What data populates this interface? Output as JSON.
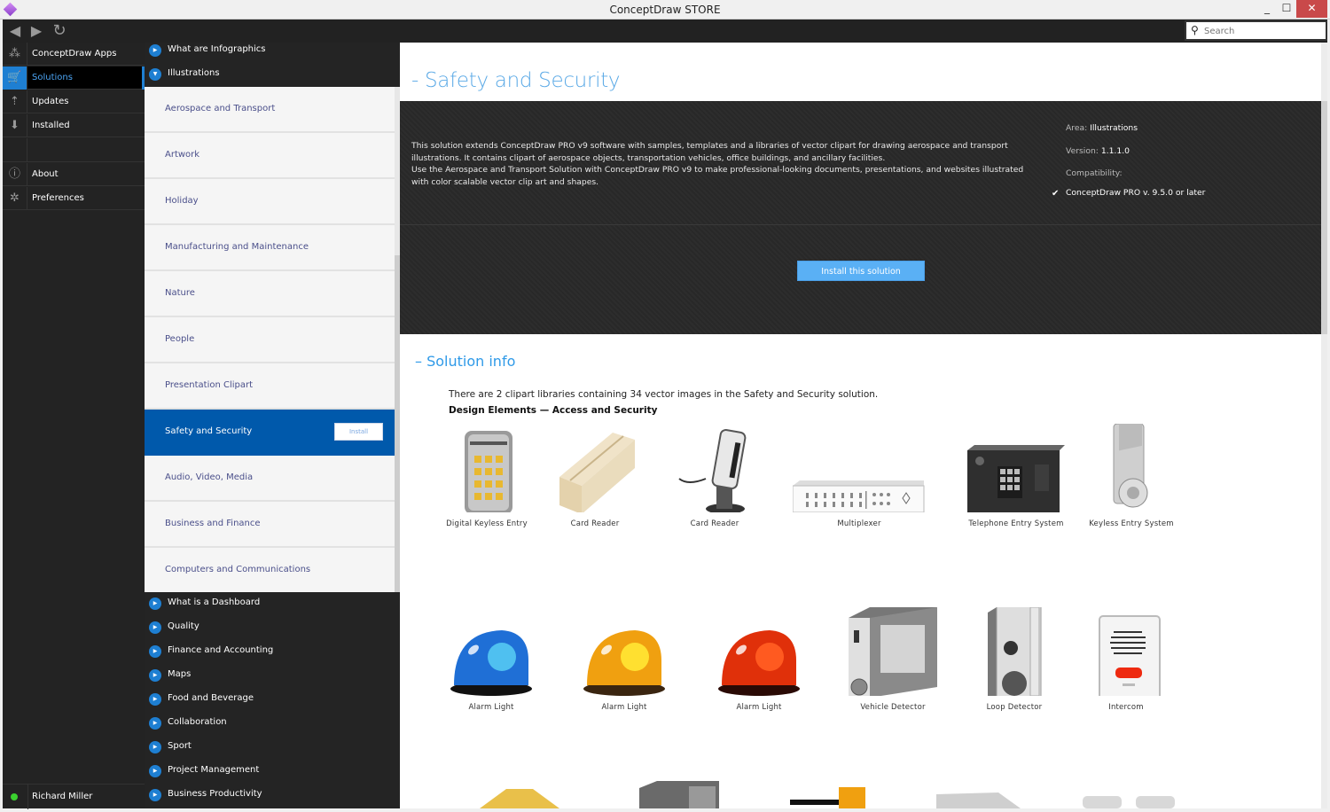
{
  "window": {
    "title": "ConceptDraw STORE",
    "controls": {
      "minimize": "_",
      "maximize": "☐",
      "close": "✕"
    }
  },
  "toolbar": {
    "back_icon": "◀",
    "forward_icon": "▶",
    "refresh_icon": "↻",
    "search_icon": "🔍",
    "search_placeholder": "Search"
  },
  "sidebar": {
    "items": [
      {
        "label": "ConceptDraw Apps",
        "icon": "apps-icon",
        "glyph": "⁂"
      },
      {
        "label": "Solutions",
        "icon": "cart-icon",
        "glyph": "🛒",
        "active": true
      },
      {
        "label": "Updates",
        "icon": "updates-icon",
        "glyph": "⇡"
      },
      {
        "label": "Installed",
        "icon": "download-icon",
        "glyph": "⬇"
      },
      {
        "label": "About",
        "icon": "info-icon",
        "glyph": "ⓘ"
      },
      {
        "label": "Preferences",
        "icon": "gear-icon",
        "glyph": "✲"
      }
    ],
    "user": {
      "name": "Richard Miller",
      "status_color": "#3bd12f"
    }
  },
  "solutions_panel": {
    "top_groups": [
      {
        "label": "What are Infographics",
        "expanded": false
      },
      {
        "label": "Illustrations",
        "expanded": true
      }
    ],
    "illustrations": [
      {
        "label": "Aerospace and Transport"
      },
      {
        "label": "Artwork"
      },
      {
        "label": "Holiday"
      },
      {
        "label": "Manufacturing and Maintenance"
      },
      {
        "label": "Nature"
      },
      {
        "label": "People"
      },
      {
        "label": "Presentation Clipart"
      },
      {
        "label": "Safety and Security",
        "active": true,
        "action": "Install"
      },
      {
        "label": "Audio, Video, Media"
      },
      {
        "label": "Business and Finance"
      },
      {
        "label": "Computers and Communications"
      }
    ],
    "bottom_groups": [
      {
        "label": "What is a Dashboard"
      },
      {
        "label": "Quality"
      },
      {
        "label": "Finance and Accounting"
      },
      {
        "label": "Maps"
      },
      {
        "label": "Food and Beverage"
      },
      {
        "label": "Collaboration"
      },
      {
        "label": "Sport"
      },
      {
        "label": "Project Management"
      },
      {
        "label": "Business Productivity"
      }
    ]
  },
  "main": {
    "title": "- Safety and Security",
    "description": [
      "This solution extends ConceptDraw PRO v9 software with samples, templates and a libraries of vector clipart for drawing aerospace and transport illustrations. It contains clipart of aerospace objects, transportation vehicles, office buildings, and ancillary facilities.",
      "Use the Aerospace and Transport Solution with ConceptDraw PRO v9 to make professional-looking documents, presentations, and websites illustrated with color scalable vector clip art and shapes."
    ],
    "meta": {
      "area_label": "Area:",
      "area_value": "Illustrations",
      "version_label": "Version:",
      "version_value": "1.1.1.0",
      "compat_label": "Compatibility:",
      "compat_value": "ConceptDraw PRO v. 9.5.0 or later"
    },
    "install_button": "Install this solution",
    "solution_info": {
      "title": "–  Solution info",
      "summary": "There are 2 clipart libraries containing 34 vector images in the Safety and Security solution.",
      "library_title": "Design Elements — Access and Security",
      "items_row1": [
        {
          "caption": "Digital Keyless Entry"
        },
        {
          "caption": "Card Reader"
        },
        {
          "caption": "Card Reader"
        },
        {
          "caption": "Multiplexer"
        },
        {
          "caption": "Telephone Entry System"
        },
        {
          "caption": "Keyless Entry System"
        }
      ],
      "items_row2": [
        {
          "caption": "Alarm Light",
          "color": "#1f6fd6"
        },
        {
          "caption": "Alarm Light",
          "color": "#f0a010"
        },
        {
          "caption": "Alarm Light",
          "color": "#e0300a"
        },
        {
          "caption": "Vehicle Detector"
        },
        {
          "caption": "Loop Detector"
        },
        {
          "caption": "Intercom"
        }
      ]
    }
  },
  "colors": {
    "accent": "#1e7fd2",
    "active_solution_bg": "#0059ab",
    "install_button": "#5ab0f5",
    "title_blue": "#5aa9e6"
  }
}
